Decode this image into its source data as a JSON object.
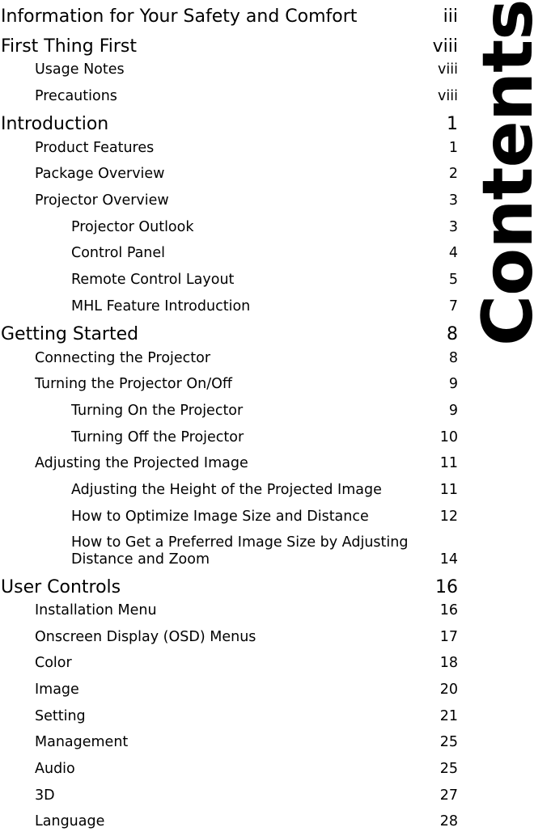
{
  "document": {
    "side_title": "Contents",
    "page_background": "#ffffff",
    "text_color": "#000000"
  },
  "toc": {
    "entries": [
      {
        "level": 1,
        "title": "Information for Your Safety and Comfort",
        "page": "iii",
        "wrapped": false
      },
      {
        "level": 1,
        "title": "First Thing First",
        "page": "viii",
        "wrapped": false
      },
      {
        "level": 2,
        "title": "Usage Notes",
        "page": "viii",
        "wrapped": false
      },
      {
        "level": 2,
        "title": "Precautions",
        "page": "viii",
        "wrapped": false
      },
      {
        "level": 1,
        "title": "Introduction",
        "page": "1",
        "wrapped": false
      },
      {
        "level": 2,
        "title": "Product Features",
        "page": "1",
        "wrapped": false
      },
      {
        "level": 2,
        "title": "Package Overview",
        "page": "2",
        "wrapped": false
      },
      {
        "level": 2,
        "title": "Projector Overview",
        "page": "3",
        "wrapped": false
      },
      {
        "level": 3,
        "title": "Projector Outlook",
        "page": "3",
        "wrapped": false
      },
      {
        "level": 3,
        "title": "Control Panel",
        "page": "4",
        "wrapped": false
      },
      {
        "level": 3,
        "title": "Remote Control Layout",
        "page": "5",
        "wrapped": false
      },
      {
        "level": 3,
        "title": "MHL Feature Introduction",
        "page": "7",
        "wrapped": false
      },
      {
        "level": 1,
        "title": "Getting Started",
        "page": "8",
        "wrapped": false
      },
      {
        "level": 2,
        "title": "Connecting the Projector",
        "page": "8",
        "wrapped": false
      },
      {
        "level": 2,
        "title": "Turning the Projector On/Off",
        "page": "9",
        "wrapped": false
      },
      {
        "level": 3,
        "title": "Turning On the Projector",
        "page": "9",
        "wrapped": false
      },
      {
        "level": 3,
        "title": "Turning Off the Projector",
        "page": "10",
        "wrapped": false
      },
      {
        "level": 2,
        "title": "Adjusting the Projected Image",
        "page": "11",
        "wrapped": false
      },
      {
        "level": 3,
        "title": "Adjusting the Height of the Projected Image",
        "page": "11",
        "wrapped": false
      },
      {
        "level": 3,
        "title": "How to Optimize Image Size and Distance",
        "page": "12",
        "wrapped": false
      },
      {
        "level": 3,
        "title": "How to Get a Preferred Image Size by Adjusting Distance and Zoom",
        "page": "14",
        "wrapped": true
      },
      {
        "level": 1,
        "title": "User Controls",
        "page": "16",
        "wrapped": false
      },
      {
        "level": 2,
        "title": "Installation Menu",
        "page": "16",
        "wrapped": false
      },
      {
        "level": 2,
        "title": "Onscreen Display (OSD) Menus",
        "page": "17",
        "wrapped": false
      },
      {
        "level": 2,
        "title": "Color",
        "page": "18",
        "wrapped": false
      },
      {
        "level": 2,
        "title": "Image",
        "page": "20",
        "wrapped": false
      },
      {
        "level": 2,
        "title": "Setting",
        "page": "21",
        "wrapped": false
      },
      {
        "level": 2,
        "title": "Management",
        "page": "25",
        "wrapped": false
      },
      {
        "level": 2,
        "title": "Audio",
        "page": "25",
        "wrapped": false
      },
      {
        "level": 2,
        "title": "3D",
        "page": "27",
        "wrapped": false
      },
      {
        "level": 2,
        "title": "Language",
        "page": "28",
        "wrapped": false
      }
    ]
  }
}
